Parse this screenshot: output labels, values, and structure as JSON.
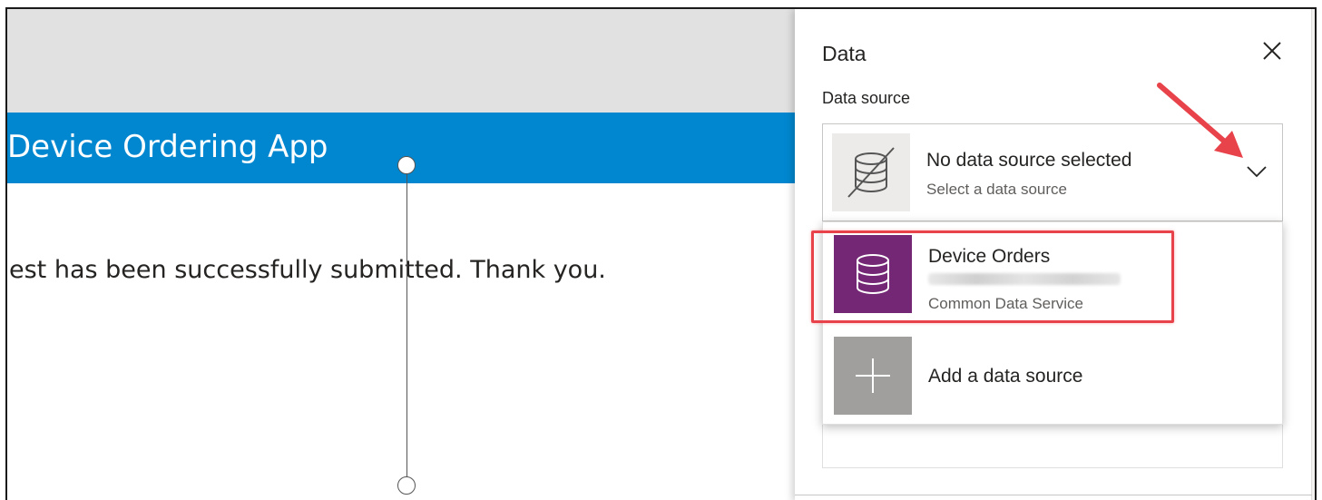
{
  "canvas": {
    "app_title": "Device Ordering App",
    "success_message": "est has been successfully submitted. Thank you."
  },
  "panel": {
    "title": "Data",
    "close_icon": "close-icon",
    "data_source_label": "Data source",
    "selector": {
      "title": "No data source selected",
      "subtitle": "Select a data source",
      "icon": "database-disconnected-icon",
      "chevron_icon": "chevron-down-icon"
    },
    "dropdown": {
      "items": [
        {
          "name": "Device Orders",
          "source": "Common Data Service",
          "icon": "database-icon",
          "icon_color": "#742774"
        },
        {
          "name": "Add a data source",
          "icon": "plus-icon",
          "icon_color": "#a19f9d"
        }
      ]
    }
  },
  "colors": {
    "header_blue": "#0087d0",
    "topbar_grey": "#e1e1e1",
    "annotation_red": "#e8434a"
  }
}
